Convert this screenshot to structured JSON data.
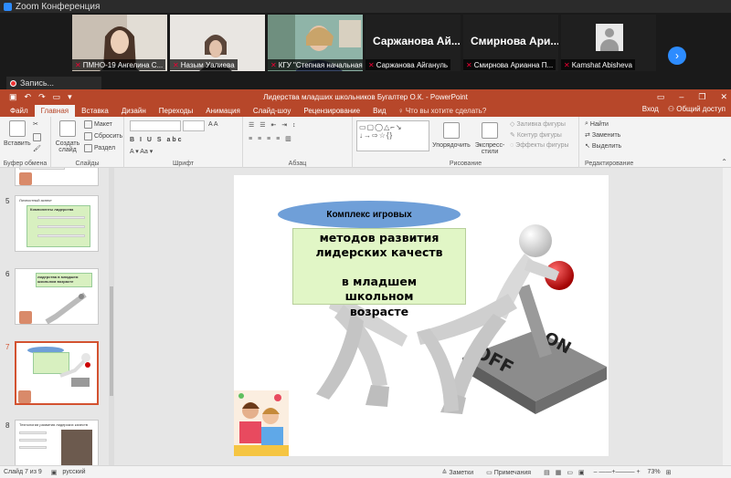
{
  "zoom": {
    "window_title": "Zoom Конференция",
    "participants": [
      {
        "name": "ПМНО-19 Ангелина С..."
      },
      {
        "name": "Назым Уалиева"
      },
      {
        "name": "КГУ \"Степная начальная ..."
      },
      {
        "name": "Саржанова Айгануль",
        "big_label": "Саржанова Ай..."
      },
      {
        "name": "Смирнова Арианна П...",
        "big_label": "Смирнова Ари..."
      },
      {
        "name": "Kamshat Abisheva"
      }
    ],
    "next_icon": "chevron-right-icon",
    "recording_label": "Запись..."
  },
  "ppt": {
    "doc_title": "Лидерства младших школьников Бугалтер О.К. - PowerPoint",
    "tabs": [
      "Файл",
      "Главная",
      "Вставка",
      "Дизайн",
      "Переходы",
      "Анимация",
      "Слайд-шоу",
      "Рецензирование",
      "Вид"
    ],
    "active_tab": "Главная",
    "search_placeholder": "Что вы хотите сделать?",
    "login": "Вход",
    "share": "Общий доступ",
    "ribbon": {
      "paste": "Вставить",
      "clipboard": "Буфер обмена",
      "new_slide": "Создать слайд",
      "layout": "Макет",
      "reset": "Сбросить",
      "section": "Раздел",
      "slides": "Слайды",
      "font": "Шрифт",
      "paragraph": "Абзац",
      "arrange": "Упорядочить",
      "quick_styles": "Экспресс-стили",
      "shape_fill": "Заливка фигуры",
      "shape_outline": "Контур фигуры",
      "shape_effects": "Эффекты фигуры",
      "drawing": "Рисование",
      "find": "Найти",
      "replace": "Заменить",
      "select": "Выделить",
      "editing": "Редактирование"
    },
    "thumbnails": [
      {
        "num": "5",
        "title": "Компоненты лидерства",
        "subtitle": "Личностный аспект"
      },
      {
        "num": "6",
        "title": "лидерства в младшем школьном возрасте"
      },
      {
        "num": "7",
        "title": "Комплекс игровых"
      },
      {
        "num": "8",
        "title": "Технологии развития лидерских качеств"
      }
    ],
    "active_slide": "7",
    "slide": {
      "oval_text": "Комплекс игровых",
      "lines": [
        "методов развития",
        "лидерских качеств",
        "",
        "в младшем",
        "школьном",
        "возрасте"
      ],
      "switch_on": "ON",
      "switch_off": "OFF"
    },
    "status": {
      "slide_info": "Слайд 7 из 9",
      "language": "русский",
      "notes": "Заметки",
      "comments": "Примечания",
      "zoom": "73%"
    }
  }
}
